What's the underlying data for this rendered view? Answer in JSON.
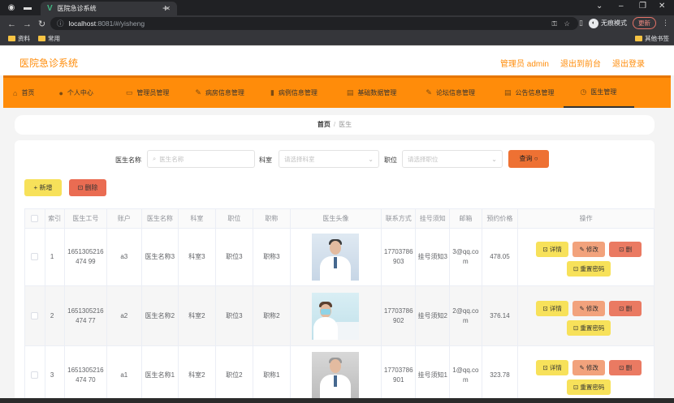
{
  "browser": {
    "tab_title": "医院急诊系统",
    "tab_logo": "V",
    "url_host": "localhost",
    "url_rest": ":8081/#/yisheng",
    "incognito_label": "无痕模式",
    "update_label": "更新",
    "bookmarks": [
      "资料",
      "常用"
    ],
    "other_bookmarks": "其他书签",
    "icons": [
      "chrome-icon",
      "back-icon",
      "forward-icon",
      "reload-icon",
      "info-icon",
      "key-icon",
      "star-icon",
      "sidepanel-icon",
      "menu-icon"
    ]
  },
  "header": {
    "title": "医院急诊系统",
    "user": "管理员 admin",
    "to_front": "退出到前台",
    "logout": "退出登录"
  },
  "menu": [
    {
      "label": "首页",
      "icon": "⌂"
    },
    {
      "label": "个人中心",
      "icon": "●"
    },
    {
      "label": "管理员管理",
      "icon": "▭"
    },
    {
      "label": "病房信息管理",
      "icon": "✎"
    },
    {
      "label": "病例信息管理",
      "icon": "▮"
    },
    {
      "label": "基础数据管理",
      "icon": "▤"
    },
    {
      "label": "论坛信息管理",
      "icon": "✎"
    },
    {
      "label": "公告信息管理",
      "icon": "▤"
    },
    {
      "label": "医生管理",
      "icon": "◷"
    }
  ],
  "breadcrumb": {
    "home": "首页",
    "sep": "/",
    "current": "医生"
  },
  "search": {
    "name_label": "医生名称",
    "name_placeholder": "医生名称",
    "dept_label": "科室",
    "dept_placeholder": "请选择科室",
    "title_label": "职位",
    "title_placeholder": "请选择职位",
    "query_label": "查询 ○"
  },
  "actions": {
    "add": "+ 新增",
    "delete": "⊡ 删除"
  },
  "table": {
    "headers": [
      "",
      "索引",
      "医生工号",
      "账户",
      "医生名称",
      "科室",
      "职位",
      "职称",
      "医生头像",
      "联系方式",
      "挂号须知",
      "邮箱",
      "预约价格",
      "操作"
    ],
    "rows": [
      {
        "index": "1",
        "code": "1651305216474 99",
        "account": "a3",
        "name": "医生名称3",
        "dept": "科室3",
        "position": "职位3",
        "rank": "职称3",
        "phone": "17703786903",
        "notice": "挂号须知3",
        "email": "3@qq.com",
        "price": "478.05"
      },
      {
        "index": "2",
        "code": "1651305216474 77",
        "account": "a2",
        "name": "医生名称2",
        "dept": "科室2",
        "position": "职位3",
        "rank": "职称2",
        "phone": "17703786902",
        "notice": "挂号须知2",
        "email": "2@qq.com",
        "price": "376.14"
      },
      {
        "index": "3",
        "code": "1651305216474 70",
        "account": "a1",
        "name": "医生名称1",
        "dept": "科室2",
        "position": "职位2",
        "rank": "职称1",
        "phone": "17703786901",
        "notice": "挂号须知1",
        "email": "1@qq.com",
        "price": "323.78"
      }
    ],
    "row_actions": {
      "detail": "⊡ 详情",
      "edit": "✎ 修改",
      "remove": "⊡ 删",
      "reset": "⊡ 重置密码"
    }
  }
}
